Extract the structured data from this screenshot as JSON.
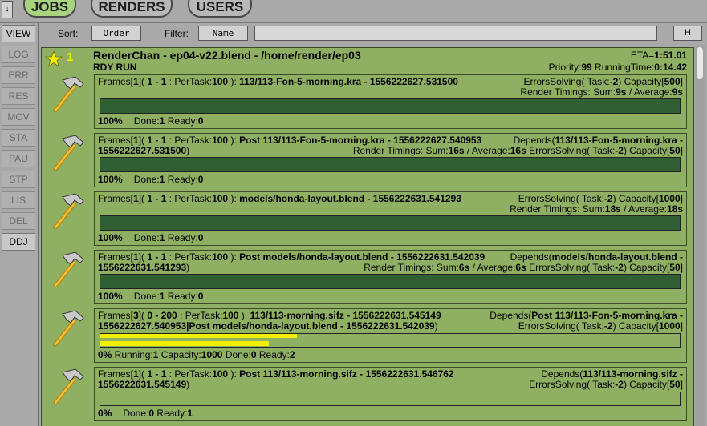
{
  "header": {
    "menu_glyph": "↓",
    "tabs": [
      {
        "label": "JOBS",
        "active": true
      },
      {
        "label": "RENDERS",
        "active": false
      },
      {
        "label": "USERS",
        "active": false
      }
    ]
  },
  "sidebar": {
    "buttons": [
      "VIEW",
      "LOG",
      "ERR",
      "RES",
      "MOV",
      "STA",
      "PAU",
      "STP",
      "LIS",
      "DEL",
      "DDJ"
    ],
    "active": [
      "VIEW",
      "DDJ"
    ]
  },
  "filterbar": {
    "sort_label": "Sort:",
    "sort_value": "Order",
    "filter_label": "Filter:",
    "filter_value": "Name",
    "filter_text": "",
    "h_label": "H"
  },
  "job": {
    "number": "1",
    "title": "RenderChan - ep04-v22.blend - /home/render/ep03",
    "state": "RDY RUN",
    "eta_label": "ETA=",
    "eta": "1:51.01",
    "priority_label": "Priority:",
    "priority": "99",
    "runtime_label": " RunningTime:",
    "runtime": "0:14.42",
    "blocks": [
      {
        "frames_count": "1",
        "frames_range": "1 - 1",
        "per_task": "100",
        "name": "113/113-Fon-5-morning.kra - 1556222627.531500",
        "depends_1": "",
        "depends_2": "",
        "errors_solving": "-2",
        "capacity": "500",
        "timing_sum": "9s",
        "timing_avg": "9s",
        "progress_percent": "100%",
        "progress": 1.0,
        "running": "",
        "capacity_run": "",
        "done": "1",
        "ready": "0"
      },
      {
        "frames_count": "1",
        "frames_range": "1 - 1",
        "per_task": "100",
        "name": "Post 113/113-Fon-5-morning.kra - 1556222627.540953",
        "depends_1": "113/113-Fon-5-morning.kra -",
        "depends_2": "1556222627.531500",
        "errors_solving": "-2",
        "capacity": "50",
        "timing_sum": "16s",
        "timing_avg": "16s",
        "progress_percent": "100%",
        "progress": 1.0,
        "running": "",
        "capacity_run": "",
        "done": "1",
        "ready": "0"
      },
      {
        "frames_count": "1",
        "frames_range": "1 - 1",
        "per_task": "100",
        "name": "models/honda-layout.blend - 1556222631.541293",
        "depends_1": "",
        "depends_2": "",
        "errors_solving": "-2",
        "capacity": "1000",
        "timing_sum": "18s",
        "timing_avg": "18s",
        "progress_percent": "100%",
        "progress": 1.0,
        "running": "",
        "capacity_run": "",
        "done": "1",
        "ready": "0"
      },
      {
        "frames_count": "1",
        "frames_range": "1 - 1",
        "per_task": "100",
        "name": "Post models/honda-layout.blend - 1556222631.542039",
        "depends_1": "models/honda-layout.blend -",
        "depends_2": "1556222631.541293",
        "errors_solving": "-2",
        "capacity": "50",
        "timing_sum": "6s",
        "timing_avg": "6s",
        "progress_percent": "100%",
        "progress": 1.0,
        "running": "",
        "capacity_run": "",
        "done": "1",
        "ready": "0"
      },
      {
        "frames_count": "3",
        "frames_range": "0 - 200",
        "per_task": "100",
        "name": "113/113-morning.sifz - 1556222631.545149",
        "depends_1": "Post 113/113-Fon-5-morning.kra -",
        "depends_2": "1556222627.540953|Post models/honda-layout.blend - 1556222631.542039",
        "errors_solving": "-2",
        "capacity": "1000",
        "timing_sum": "",
        "timing_avg": "",
        "progress_percent": "0%",
        "progress": 0.0,
        "running": "1",
        "capacity_run": "1000",
        "done": "0",
        "ready": "2"
      },
      {
        "frames_count": "1",
        "frames_range": "1 - 1",
        "per_task": "100",
        "name": "Post 113/113-morning.sifz - 1556222631.546762",
        "depends_1": "113/113-morning.sifz -",
        "depends_2": "1556222631.545149",
        "errors_solving": "-2",
        "capacity": "50",
        "timing_sum": "",
        "timing_avg": "",
        "progress_percent": "0%",
        "progress": 0.0,
        "running": "",
        "capacity_run": "",
        "done": "0",
        "ready": "1"
      }
    ]
  },
  "colors": {
    "job_bg": "#8fb062",
    "progress_done": "#315f34",
    "running_stripe": "#f2f000",
    "active_tab": "#a9d47f"
  }
}
